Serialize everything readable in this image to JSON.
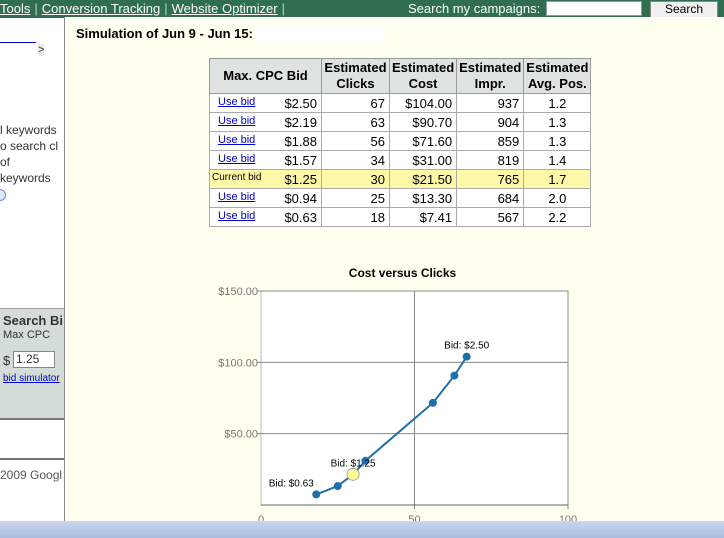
{
  "topbar": {
    "links": [
      "Tools",
      "Conversion Tracking",
      "Website Optimizer"
    ],
    "search_label": "Search my campaigns:",
    "search_value": "",
    "search_button": "Search"
  },
  "left": {
    "breadcrumb_sep": ">",
    "text_lines": [
      "l keywords",
      "o search cl",
      "of keywords"
    ],
    "section_title": "Search Bi",
    "max_cpc_label": "Max CPC",
    "currency": "$",
    "max_cpc_value": "1.25",
    "bid_simulator_link": "bid simulator",
    "footer": "2009 Googl"
  },
  "modal": {
    "title": "Simulation of Jun 9 - Jun 15:",
    "table": {
      "headers": [
        "Max. CPC Bid",
        "Estimated Clicks",
        "Estimated Cost",
        "Estimated Impr.",
        "Estimated Avg. Pos."
      ],
      "rows": [
        {
          "action": "Use bid",
          "bid": "$2.50",
          "clicks": "67",
          "cost": "$104.00",
          "impr": "937",
          "pos": "1.2"
        },
        {
          "action": "Use bid",
          "bid": "$2.19",
          "clicks": "63",
          "cost": "$90.70",
          "impr": "904",
          "pos": "1.3"
        },
        {
          "action": "Use bid",
          "bid": "$1.88",
          "clicks": "56",
          "cost": "$71.60",
          "impr": "859",
          "pos": "1.3"
        },
        {
          "action": "Use bid",
          "bid": "$1.57",
          "clicks": "34",
          "cost": "$31.00",
          "impr": "819",
          "pos": "1.4"
        },
        {
          "action": "Current bid",
          "bid": "$1.25",
          "clicks": "30",
          "cost": "$21.50",
          "impr": "765",
          "pos": "1.7",
          "current": true
        },
        {
          "action": "Use bid",
          "bid": "$0.94",
          "clicks": "25",
          "cost": "$13.30",
          "impr": "684",
          "pos": "2.0"
        },
        {
          "action": "Use bid",
          "bid": "$0.63",
          "clicks": "18",
          "cost": "$7.41",
          "impr": "567",
          "pos": "2.2"
        }
      ]
    }
  },
  "chart_data": {
    "type": "line",
    "title": "Cost versus Clicks",
    "xlabel": "",
    "ylabel": "",
    "xlim": [
      0,
      100
    ],
    "ylim": [
      0,
      150
    ],
    "x_ticks": [
      "0",
      "50",
      "100"
    ],
    "y_ticks": [
      "$50.00",
      "$100.00",
      "$150.00"
    ],
    "grid": true,
    "x": [
      18,
      25,
      30,
      34,
      56,
      63,
      67
    ],
    "y": [
      7.41,
      13.3,
      21.5,
      31.0,
      71.6,
      90.7,
      104.0
    ],
    "annotations": [
      {
        "x": 18,
        "y": 7.41,
        "text": "Bid: $0.63"
      },
      {
        "x": 30,
        "y": 21.5,
        "text": "Bid: $1.25"
      },
      {
        "x": 67,
        "y": 104.0,
        "text": "Bid: $2.50"
      }
    ],
    "highlight_index": 2,
    "colors": {
      "line": "#1f6fa8",
      "highlight": "#ffff99"
    }
  }
}
